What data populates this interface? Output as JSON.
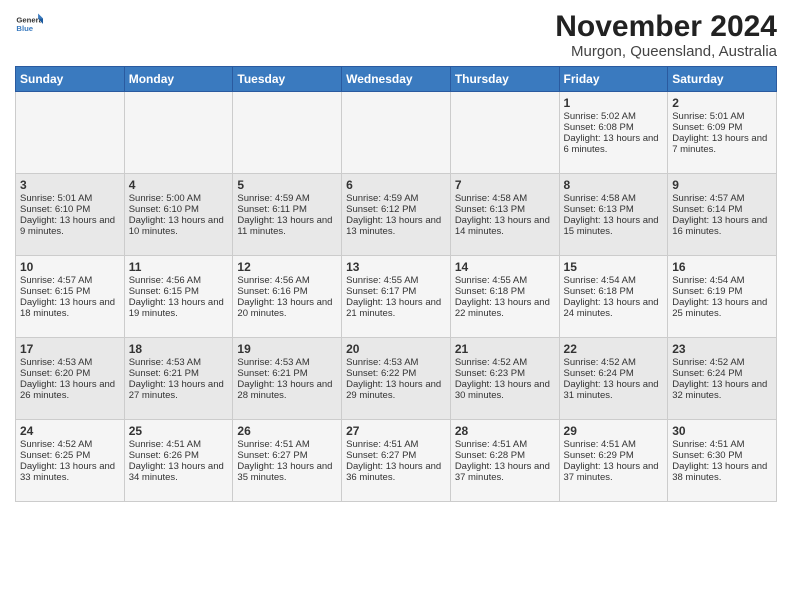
{
  "logo": {
    "general": "General",
    "blue": "Blue"
  },
  "title": "November 2024",
  "location": "Murgon, Queensland, Australia",
  "headers": [
    "Sunday",
    "Monday",
    "Tuesday",
    "Wednesday",
    "Thursday",
    "Friday",
    "Saturday"
  ],
  "weeks": [
    [
      {
        "day": "",
        "content": ""
      },
      {
        "day": "",
        "content": ""
      },
      {
        "day": "",
        "content": ""
      },
      {
        "day": "",
        "content": ""
      },
      {
        "day": "",
        "content": ""
      },
      {
        "day": "1",
        "content": "Sunrise: 5:02 AM\nSunset: 6:08 PM\nDaylight: 13 hours and 6 minutes."
      },
      {
        "day": "2",
        "content": "Sunrise: 5:01 AM\nSunset: 6:09 PM\nDaylight: 13 hours and 7 minutes."
      }
    ],
    [
      {
        "day": "3",
        "content": "Sunrise: 5:01 AM\nSunset: 6:10 PM\nDaylight: 13 hours and 9 minutes."
      },
      {
        "day": "4",
        "content": "Sunrise: 5:00 AM\nSunset: 6:10 PM\nDaylight: 13 hours and 10 minutes."
      },
      {
        "day": "5",
        "content": "Sunrise: 4:59 AM\nSunset: 6:11 PM\nDaylight: 13 hours and 11 minutes."
      },
      {
        "day": "6",
        "content": "Sunrise: 4:59 AM\nSunset: 6:12 PM\nDaylight: 13 hours and 13 minutes."
      },
      {
        "day": "7",
        "content": "Sunrise: 4:58 AM\nSunset: 6:13 PM\nDaylight: 13 hours and 14 minutes."
      },
      {
        "day": "8",
        "content": "Sunrise: 4:58 AM\nSunset: 6:13 PM\nDaylight: 13 hours and 15 minutes."
      },
      {
        "day": "9",
        "content": "Sunrise: 4:57 AM\nSunset: 6:14 PM\nDaylight: 13 hours and 16 minutes."
      }
    ],
    [
      {
        "day": "10",
        "content": "Sunrise: 4:57 AM\nSunset: 6:15 PM\nDaylight: 13 hours and 18 minutes."
      },
      {
        "day": "11",
        "content": "Sunrise: 4:56 AM\nSunset: 6:15 PM\nDaylight: 13 hours and 19 minutes."
      },
      {
        "day": "12",
        "content": "Sunrise: 4:56 AM\nSunset: 6:16 PM\nDaylight: 13 hours and 20 minutes."
      },
      {
        "day": "13",
        "content": "Sunrise: 4:55 AM\nSunset: 6:17 PM\nDaylight: 13 hours and 21 minutes."
      },
      {
        "day": "14",
        "content": "Sunrise: 4:55 AM\nSunset: 6:18 PM\nDaylight: 13 hours and 22 minutes."
      },
      {
        "day": "15",
        "content": "Sunrise: 4:54 AM\nSunset: 6:18 PM\nDaylight: 13 hours and 24 minutes."
      },
      {
        "day": "16",
        "content": "Sunrise: 4:54 AM\nSunset: 6:19 PM\nDaylight: 13 hours and 25 minutes."
      }
    ],
    [
      {
        "day": "17",
        "content": "Sunrise: 4:53 AM\nSunset: 6:20 PM\nDaylight: 13 hours and 26 minutes."
      },
      {
        "day": "18",
        "content": "Sunrise: 4:53 AM\nSunset: 6:21 PM\nDaylight: 13 hours and 27 minutes."
      },
      {
        "day": "19",
        "content": "Sunrise: 4:53 AM\nSunset: 6:21 PM\nDaylight: 13 hours and 28 minutes."
      },
      {
        "day": "20",
        "content": "Sunrise: 4:53 AM\nSunset: 6:22 PM\nDaylight: 13 hours and 29 minutes."
      },
      {
        "day": "21",
        "content": "Sunrise: 4:52 AM\nSunset: 6:23 PM\nDaylight: 13 hours and 30 minutes."
      },
      {
        "day": "22",
        "content": "Sunrise: 4:52 AM\nSunset: 6:24 PM\nDaylight: 13 hours and 31 minutes."
      },
      {
        "day": "23",
        "content": "Sunrise: 4:52 AM\nSunset: 6:24 PM\nDaylight: 13 hours and 32 minutes."
      }
    ],
    [
      {
        "day": "24",
        "content": "Sunrise: 4:52 AM\nSunset: 6:25 PM\nDaylight: 13 hours and 33 minutes."
      },
      {
        "day": "25",
        "content": "Sunrise: 4:51 AM\nSunset: 6:26 PM\nDaylight: 13 hours and 34 minutes."
      },
      {
        "day": "26",
        "content": "Sunrise: 4:51 AM\nSunset: 6:27 PM\nDaylight: 13 hours and 35 minutes."
      },
      {
        "day": "27",
        "content": "Sunrise: 4:51 AM\nSunset: 6:27 PM\nDaylight: 13 hours and 36 minutes."
      },
      {
        "day": "28",
        "content": "Sunrise: 4:51 AM\nSunset: 6:28 PM\nDaylight: 13 hours and 37 minutes."
      },
      {
        "day": "29",
        "content": "Sunrise: 4:51 AM\nSunset: 6:29 PM\nDaylight: 13 hours and 37 minutes."
      },
      {
        "day": "30",
        "content": "Sunrise: 4:51 AM\nSunset: 6:30 PM\nDaylight: 13 hours and 38 minutes."
      }
    ]
  ]
}
